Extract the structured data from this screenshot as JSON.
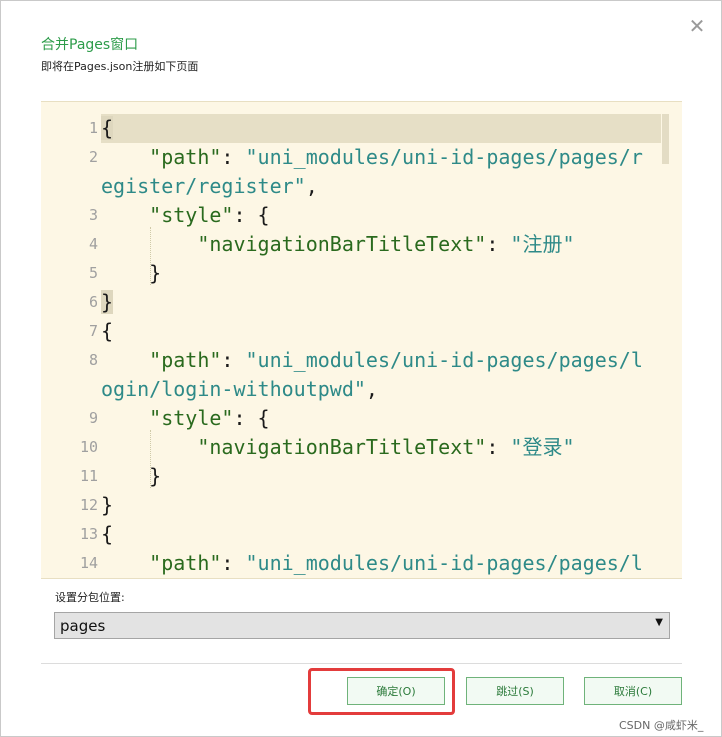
{
  "dialog": {
    "title": "合并Pages窗口",
    "subtitle": "即将在Pages.json注册如下页面",
    "close_label": "✕"
  },
  "editor": {
    "lines": [
      {
        "n": "1",
        "parts": [
          {
            "t": "{",
            "c": "bm"
          }
        ]
      },
      {
        "n": "2",
        "parts": [
          {
            "t": "    ",
            "c": ""
          },
          {
            "t": "\"path\"",
            "c": "key"
          },
          {
            "t": ": ",
            "c": ""
          },
          {
            "t": "\"uni_modules/uni-id-pages/pages/r",
            "c": "str"
          }
        ]
      },
      {
        "n": "",
        "parts": [
          {
            "t": "egister/register\"",
            "c": "str"
          },
          {
            "t": ",",
            "c": ""
          }
        ]
      },
      {
        "n": "3",
        "parts": [
          {
            "t": "    ",
            "c": ""
          },
          {
            "t": "\"style\"",
            "c": "key"
          },
          {
            "t": ": {",
            "c": ""
          }
        ]
      },
      {
        "n": "4",
        "parts": [
          {
            "t": "        ",
            "c": ""
          },
          {
            "t": "\"navigationBarTitleText\"",
            "c": "key"
          },
          {
            "t": ": ",
            "c": ""
          },
          {
            "t": "\"注册\"",
            "c": "str"
          }
        ]
      },
      {
        "n": "5",
        "parts": [
          {
            "t": "    }",
            "c": ""
          }
        ]
      },
      {
        "n": "6",
        "parts": [
          {
            "t": "}",
            "c": "bm"
          }
        ]
      },
      {
        "n": "7",
        "parts": [
          {
            "t": "{",
            "c": ""
          }
        ]
      },
      {
        "n": "8",
        "parts": [
          {
            "t": "    ",
            "c": ""
          },
          {
            "t": "\"path\"",
            "c": "key"
          },
          {
            "t": ": ",
            "c": ""
          },
          {
            "t": "\"uni_modules/uni-id-pages/pages/l",
            "c": "str"
          }
        ]
      },
      {
        "n": "",
        "parts": [
          {
            "t": "ogin/login-withoutpwd\"",
            "c": "str"
          },
          {
            "t": ",",
            "c": ""
          }
        ]
      },
      {
        "n": "9",
        "parts": [
          {
            "t": "    ",
            "c": ""
          },
          {
            "t": "\"style\"",
            "c": "key"
          },
          {
            "t": ": {",
            "c": ""
          }
        ]
      },
      {
        "n": "10",
        "parts": [
          {
            "t": "        ",
            "c": ""
          },
          {
            "t": "\"navigationBarTitleText\"",
            "c": "key"
          },
          {
            "t": ": ",
            "c": ""
          },
          {
            "t": "\"登录\"",
            "c": "str"
          }
        ]
      },
      {
        "n": "11",
        "parts": [
          {
            "t": "    }",
            "c": ""
          }
        ]
      },
      {
        "n": "12",
        "parts": [
          {
            "t": "}",
            "c": ""
          }
        ]
      },
      {
        "n": "13",
        "parts": [
          {
            "t": "{",
            "c": ""
          }
        ]
      },
      {
        "n": "14",
        "parts": [
          {
            "t": "    ",
            "c": ""
          },
          {
            "t": "\"path\"",
            "c": "key"
          },
          {
            "t": ": ",
            "c": ""
          },
          {
            "t": "\"uni_modules/uni-id-pages/pages/l",
            "c": "str"
          }
        ]
      }
    ]
  },
  "subpackage": {
    "label": "设置分包位置:",
    "selected": "pages"
  },
  "buttons": {
    "confirm": "确定(O)",
    "skip": "跳过(S)",
    "cancel": "取消(C)"
  },
  "watermark": "CSDN @咸虾米_"
}
